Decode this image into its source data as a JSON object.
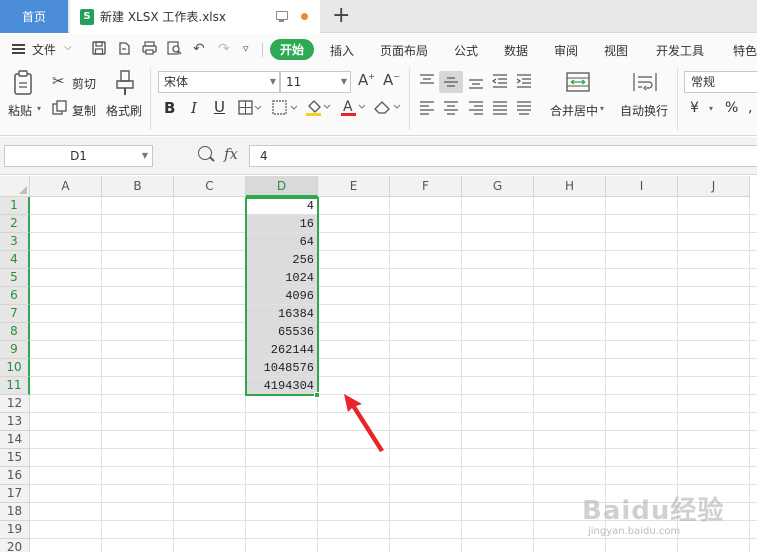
{
  "tabbar": {
    "home_tab": "首页",
    "doc_icon_letter": "S",
    "doc_title": "新建 XLSX 工作表.xlsx",
    "new_tab": "+"
  },
  "menubar": {
    "file": "文件",
    "tabs": [
      "开始",
      "插入",
      "页面布局",
      "公式",
      "数据",
      "审阅",
      "视图",
      "开发工具",
      "特色"
    ],
    "active_tab": "开始"
  },
  "ribbon": {
    "paste": "粘贴",
    "cut": "剪切",
    "copy": "复制",
    "format_painter": "格式刷",
    "font_name": "宋体",
    "font_size": "11",
    "merge_center": "合并居中",
    "wrap_text": "自动换行",
    "number_format": "常规",
    "currency_symbol": "¥",
    "percent_symbol": "%",
    "bold": "B",
    "italic": "I",
    "underline": "U"
  },
  "formula_bar": {
    "name_box": "D1",
    "fx": "fx",
    "value": "4"
  },
  "grid": {
    "columns": [
      "A",
      "B",
      "C",
      "D",
      "E",
      "F",
      "G",
      "H",
      "I",
      "J"
    ],
    "selected_column": "D",
    "rows": [
      "1",
      "2",
      "3",
      "4",
      "5",
      "6",
      "7",
      "8",
      "9",
      "10",
      "11",
      "12",
      "13",
      "14",
      "15",
      "16",
      "17",
      "18",
      "19",
      "20"
    ],
    "column_d_values": [
      "4",
      "16",
      "64",
      "256",
      "1024",
      "4096",
      "16384",
      "65536",
      "262144",
      "1048576",
      "4194304"
    ]
  },
  "watermark": {
    "text": "Baidu经验",
    "url": "jingyan.baidu.com"
  },
  "colors": {
    "accent_green": "#2ea84f",
    "home_tab_blue": "#4a8cd8",
    "arrow_red": "#e8232a"
  }
}
